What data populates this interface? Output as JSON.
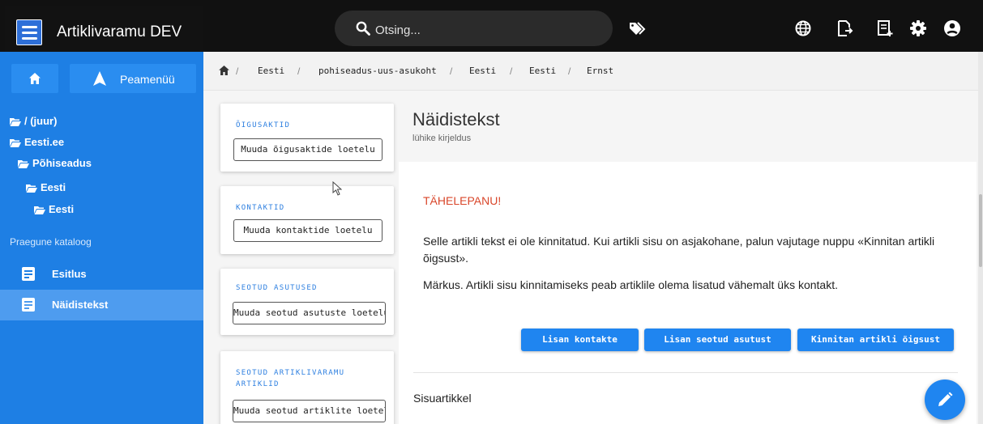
{
  "app": {
    "title": "Artiklivaramu DEV",
    "search_placeholder": "Otsing...",
    "accent_color": "#1e7fe4",
    "topbar_icons": [
      "tags-icon",
      "globe-icon",
      "export-icon",
      "add-note-icon",
      "settings-icon",
      "account-icon"
    ]
  },
  "sidebar": {
    "home_icon": "home-icon",
    "main_menu_label": "Peamenüü",
    "tree": [
      {
        "label": "/ (juur)"
      },
      {
        "label": "Eesti.ee"
      },
      {
        "label": "Põhiseadus"
      },
      {
        "label": "Eesti"
      },
      {
        "label": "Eesti"
      }
    ],
    "current_catalog_label": "Praegune kataloog",
    "documents": [
      {
        "label": "Esitlus",
        "active": false
      },
      {
        "label": "Näidistekst",
        "active": true
      }
    ]
  },
  "breadcrumb": [
    "Eesti",
    "pohiseadus-uus-asukoht",
    "Eesti",
    "Eesti",
    "Ernst"
  ],
  "cards": [
    {
      "label": "ÕIGUSAKTID",
      "button": "Muuda õigusaktide loetelu"
    },
    {
      "label": "KONTAKTID",
      "button": "Muuda kontaktide loetelu"
    },
    {
      "label": "SEOTUD ASUTUSED",
      "button": "Muuda seotud asutuste loetelu"
    },
    {
      "label": "SEOTUD ARTIKLIVARAMU ARTIKLID",
      "button": "Muuda seotud artiklite loetelu"
    }
  ],
  "article": {
    "title": "Näidistekst",
    "subtitle": "lühike kirjeldus",
    "warning_title": "TÄHELEPANU!",
    "warning_text": "Selle artikli tekst ei ole kinnitatud. Kui artikli sisu on asjakohane, palun vajutage nuppu «Kinnitan artikli õigsust».",
    "note_text": "Märkus. Artikli sisu kinnitamiseks peab artiklile olema lisatud vähemalt üks kontakt.",
    "buttons": [
      "Lisan kontakte",
      "Lisan seotud asutust",
      "Kinnitan artikli õigsust"
    ],
    "section_heading": "Sisuartikkel"
  },
  "fab_icon": "edit-pencil-icon"
}
